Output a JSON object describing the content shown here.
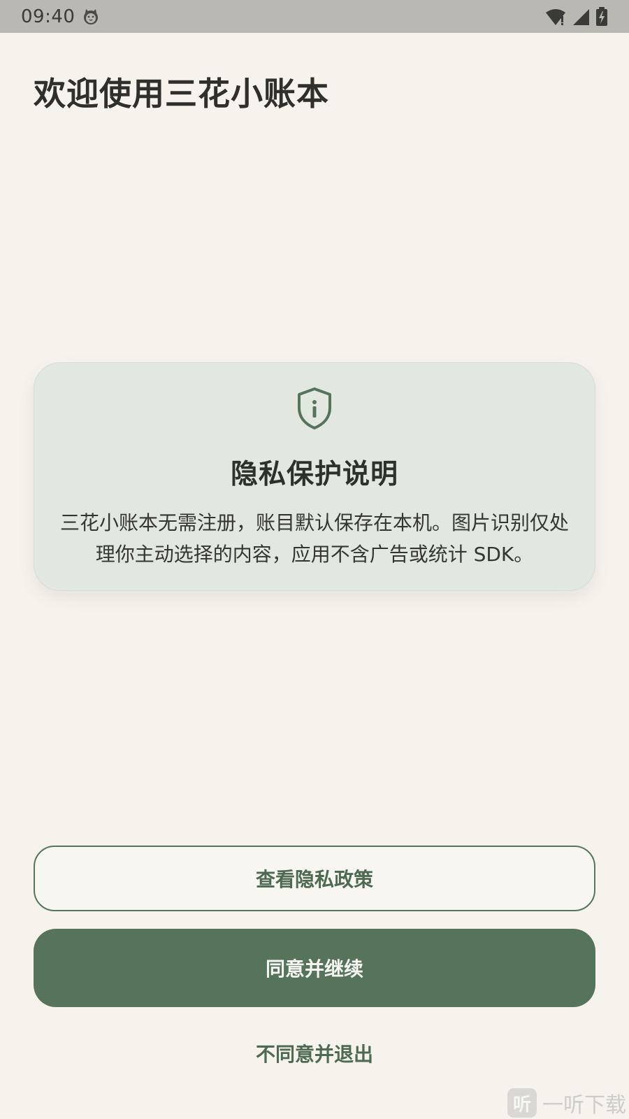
{
  "status_bar": {
    "time": "09:40",
    "icons": [
      "cat-notification-icon",
      "wifi-icon",
      "signal-icon",
      "battery-charging-icon"
    ]
  },
  "page": {
    "title": "欢迎使用三花小账本"
  },
  "card": {
    "icon": "shield-info-icon",
    "title": "隐私保护说明",
    "body": "三花小账本无需注册，账目默认保存在本机。图片识别仅处理你主动选择的内容，应用不含广告或统计 SDK。"
  },
  "actions": {
    "view_policy": "查看隐私政策",
    "agree": "同意并继续",
    "disagree": "不同意并退出"
  },
  "watermark": {
    "logo_text": "听",
    "text": "一听下载"
  },
  "colors": {
    "background": "#f6f3ec",
    "accent": "#56735b",
    "card_background": "#e2e8e0",
    "status_bar": "#b9b8b3"
  }
}
